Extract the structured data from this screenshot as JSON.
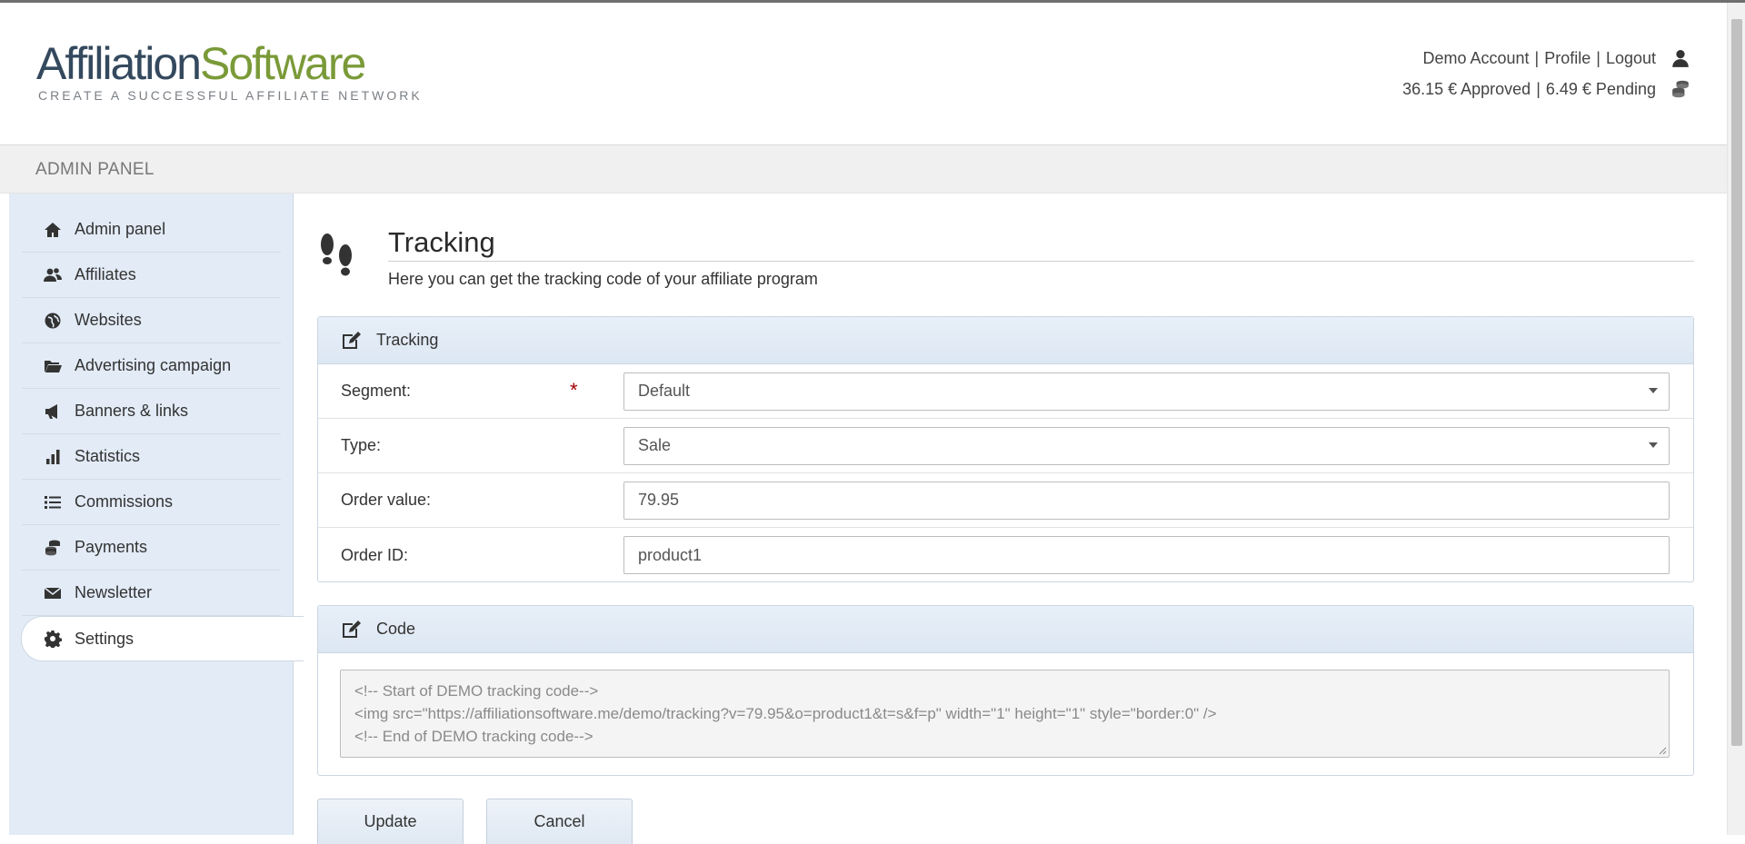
{
  "brand": {
    "logo_part1": "Affiliation",
    "logo_part2": "Software",
    "tagline": "CREATE A SUCCESSFUL AFFILIATE NETWORK"
  },
  "account": {
    "name": "Demo Account",
    "profile": "Profile",
    "logout": "Logout",
    "separator": "|",
    "approved": "36.15 € Approved",
    "pending": "6.49 € Pending"
  },
  "panel_bar": {
    "label": "ADMIN PANEL"
  },
  "sidebar": {
    "items": [
      {
        "label": "Admin panel",
        "icon": "home-icon"
      },
      {
        "label": "Affiliates",
        "icon": "users-icon"
      },
      {
        "label": "Websites",
        "icon": "globe-icon"
      },
      {
        "label": "Advertising campaign",
        "icon": "folder-icon"
      },
      {
        "label": "Banners & links",
        "icon": "megaphone-icon"
      },
      {
        "label": "Statistics",
        "icon": "bar-chart-icon"
      },
      {
        "label": "Commissions",
        "icon": "list-icon"
      },
      {
        "label": "Payments",
        "icon": "coins-icon"
      },
      {
        "label": "Newsletter",
        "icon": "envelope-icon"
      },
      {
        "label": "Settings",
        "icon": "gear-icon",
        "active": true
      }
    ]
  },
  "page": {
    "title": "Tracking",
    "subtitle": "Here you can get the tracking code of your affiliate program"
  },
  "tracking_card": {
    "title": "Tracking",
    "fields": {
      "segment": {
        "label": "Segment:",
        "required_mark": "*",
        "value": "Default"
      },
      "type": {
        "label": "Type:",
        "value": "Sale"
      },
      "order_value": {
        "label": "Order value:",
        "value": "79.95"
      },
      "order_id": {
        "label": "Order ID:",
        "value": "product1"
      }
    }
  },
  "code_card": {
    "title": "Code",
    "lines": [
      "<!-- Start of DEMO tracking code-->",
      "<img src=\"https://affiliationsoftware.me/demo/tracking?v=79.95&o=product1&t=s&f=p\" width=\"1\" height=\"1\" style=\"border:0\" />",
      "<!-- End of DEMO tracking code-->"
    ]
  },
  "buttons": {
    "update": "Update",
    "cancel": "Cancel"
  },
  "colors": {
    "logo_dark": "#34495e",
    "logo_green": "#7a9a38",
    "sidebar_bg": "#e2ebf6",
    "required": "#a30000"
  }
}
